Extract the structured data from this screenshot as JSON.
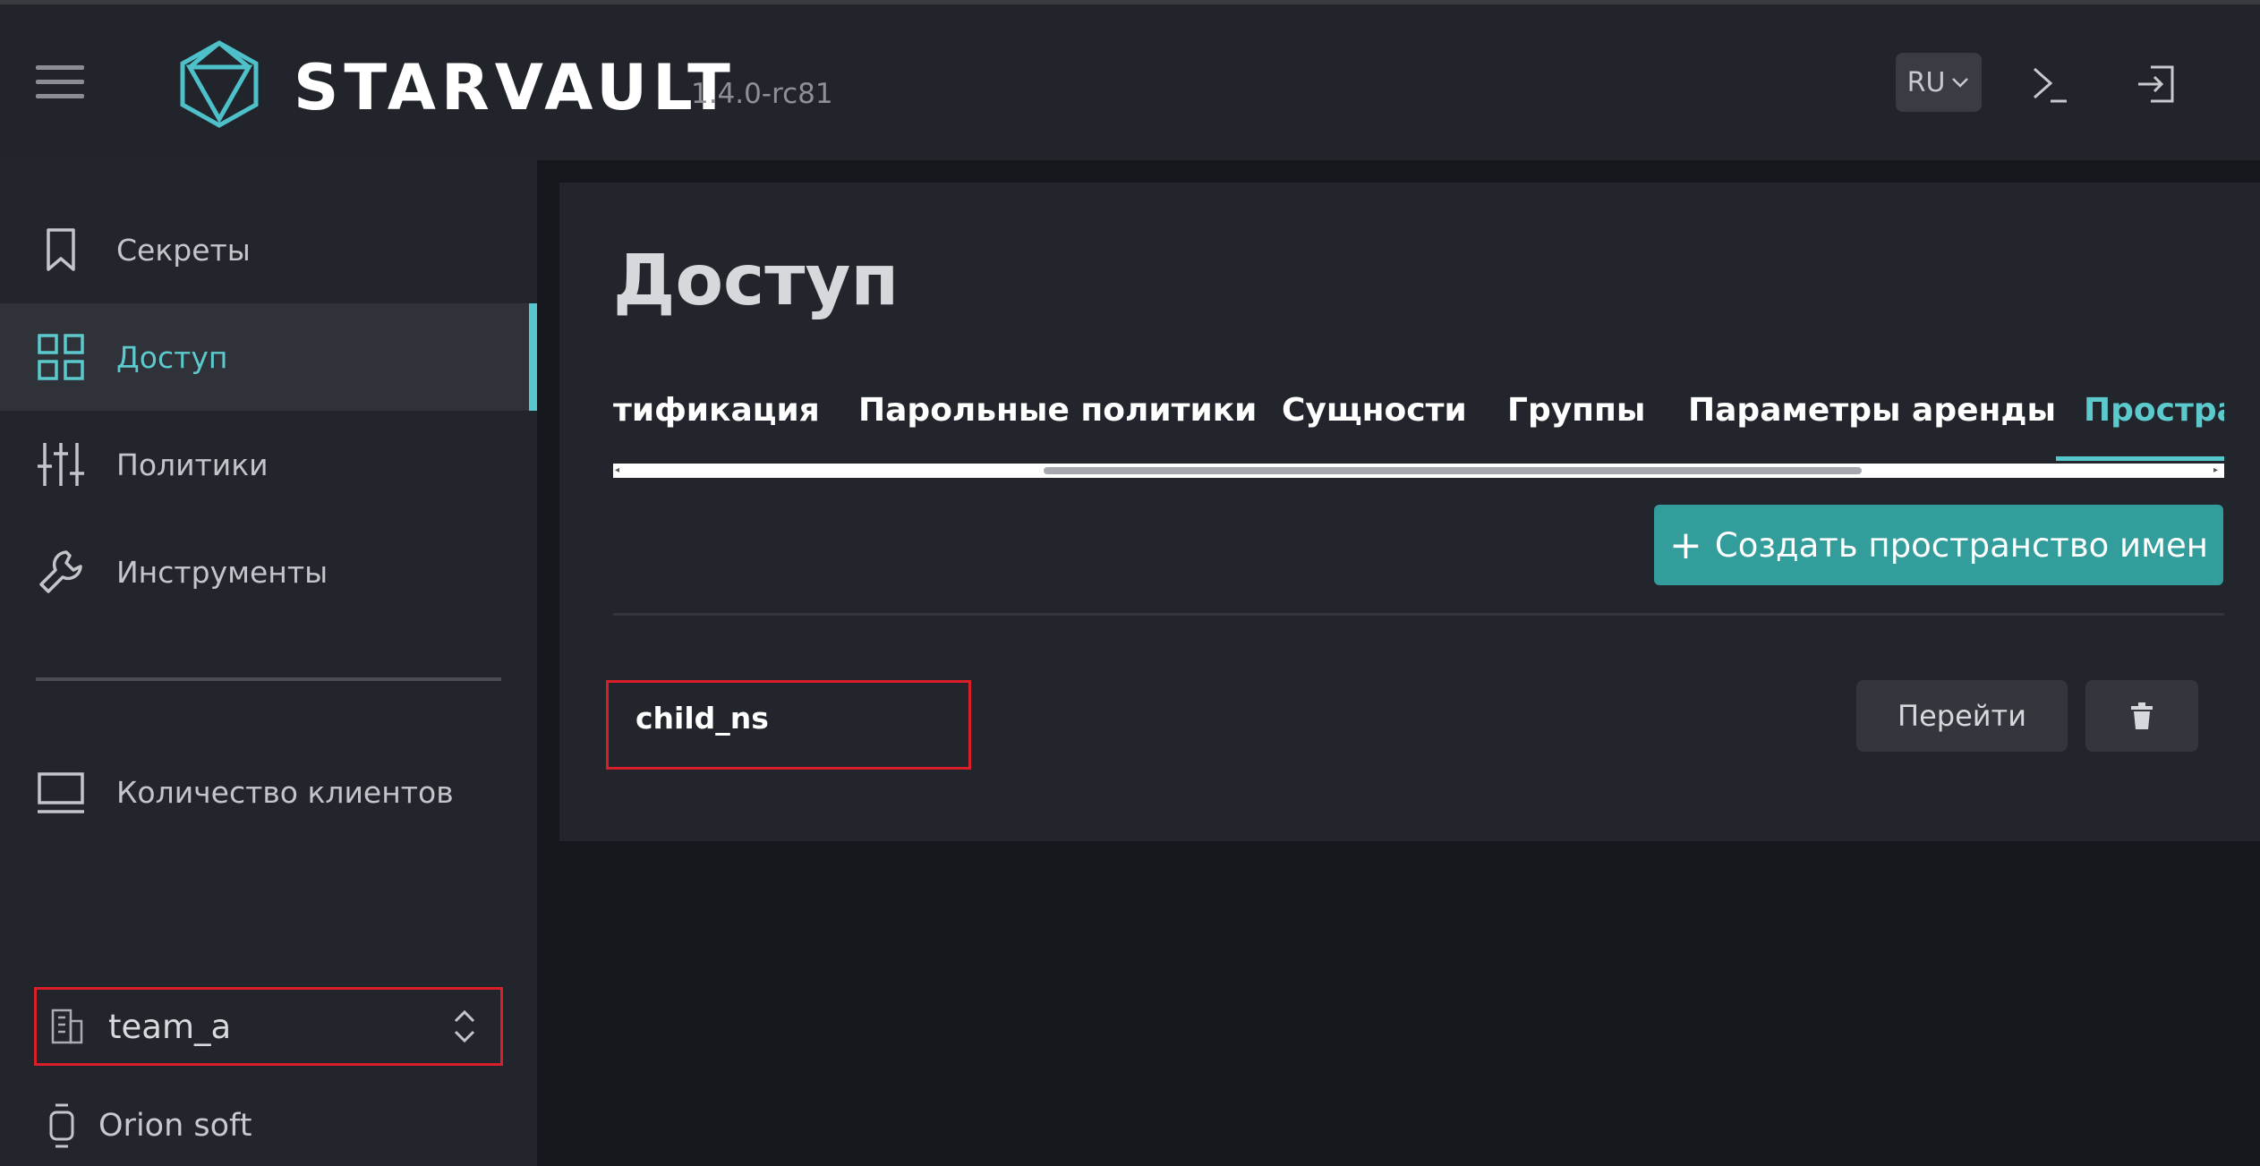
{
  "app": {
    "brand": "STARVAULT",
    "version": "1.4.0-rc81"
  },
  "header": {
    "language": "RU"
  },
  "sidebar": {
    "items": [
      {
        "label": "Секреты",
        "icon": "bookmark-icon"
      },
      {
        "label": "Доступ",
        "icon": "grid-icon",
        "active": true
      },
      {
        "label": "Политики",
        "icon": "sliders-icon"
      },
      {
        "label": "Инструменты",
        "icon": "wrench-icon"
      },
      {
        "label": "Количество клиентов",
        "icon": "monitor-icon"
      }
    ],
    "namespace": "team_a",
    "organization": "Orion soft"
  },
  "main": {
    "title": "Доступ",
    "tabs": [
      {
        "label": "тификация"
      },
      {
        "label": "Парольные политики"
      },
      {
        "label": "Сущности"
      },
      {
        "label": "Группы"
      },
      {
        "label": "Параметры аренды"
      },
      {
        "label": "Простра",
        "active": true
      }
    ],
    "create_button": "Создать пространство имен",
    "namespaces": [
      {
        "name": "child_ns",
        "go_label": "Перейти"
      }
    ]
  },
  "colors": {
    "accent": "#56c7cc",
    "button": "#329d9b",
    "highlight": "#d91f2a"
  }
}
